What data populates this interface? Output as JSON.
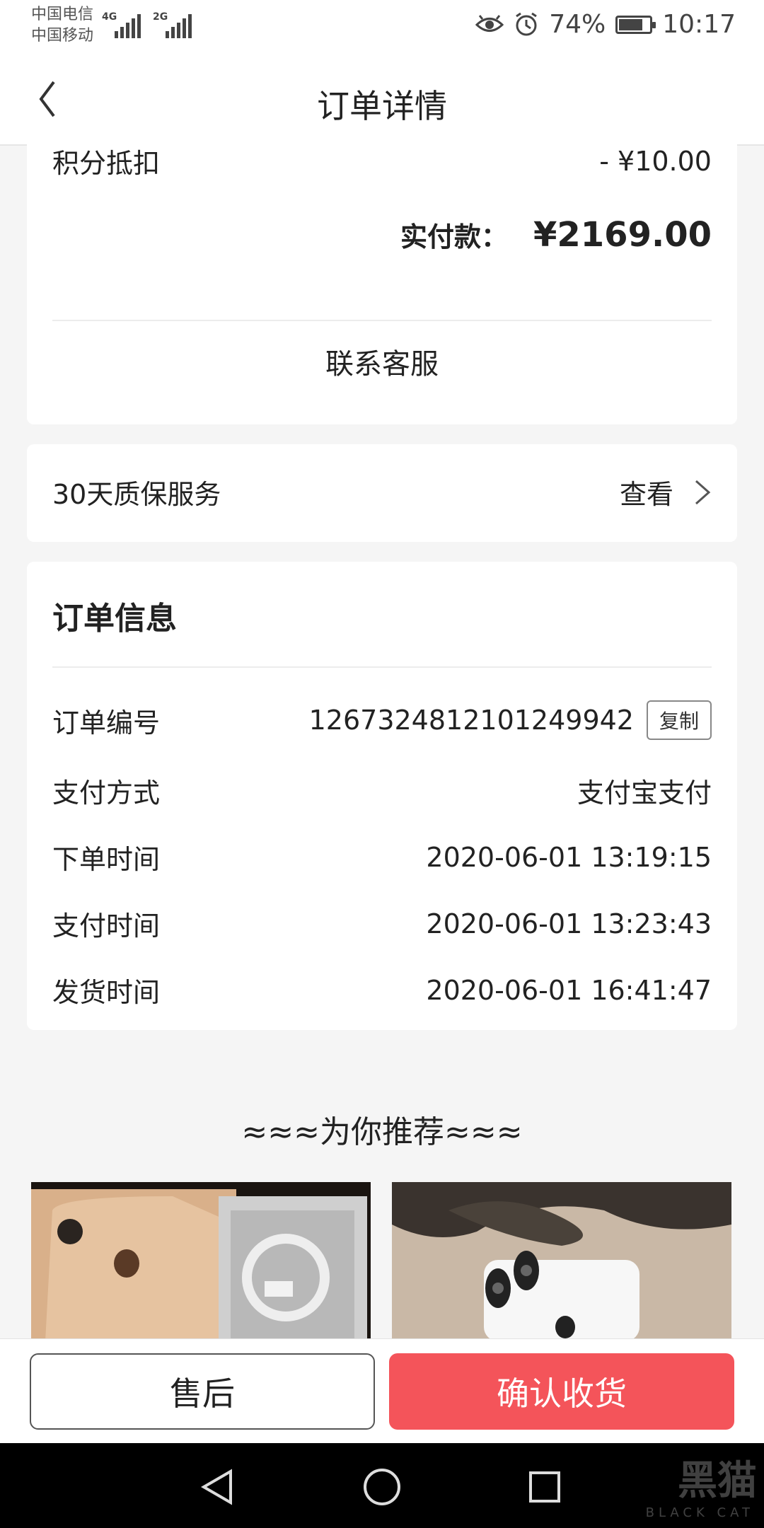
{
  "status_bar": {
    "carrier_1": "中国电信",
    "carrier_2": "中国移动",
    "net_1": "4G",
    "net_2": "2G",
    "battery_percent": "74%",
    "battery_level": 0.74,
    "time": "10:17",
    "icons": [
      "eye-icon",
      "alarm-icon",
      "battery-icon"
    ]
  },
  "header": {
    "title": "订单详情",
    "back_icon": "chevron-left-icon"
  },
  "payment_card": {
    "points_label": "积分抵扣",
    "points_value": "- ¥10.00",
    "paid_label": "实付款：",
    "paid_amount": "¥2169.00",
    "contact_label": "联系客服"
  },
  "warranty_card": {
    "label": "30天质保服务",
    "action": "查看"
  },
  "order_info": {
    "title": "订单信息",
    "rows": [
      {
        "label": "订单编号",
        "value": "1267324812101249942",
        "button": "复制"
      },
      {
        "label": "支付方式",
        "value": "支付宝支付"
      },
      {
        "label": "下单时间",
        "value": "2020-06-01 13:19:15"
      },
      {
        "label": "支付时间",
        "value": "2020-06-01 13:23:43"
      },
      {
        "label": "发货时间",
        "value": "2020-06-01 16:41:47"
      }
    ]
  },
  "recommend": {
    "title": "≈≈≈为你推荐≈≈≈"
  },
  "actions": {
    "after_sale": "售后",
    "confirm": "确认收货"
  },
  "watermark": {
    "text": "黑猫",
    "sub": "BLACK CAT"
  },
  "colors": {
    "accent": "#f4545a",
    "background": "#f5f5f5"
  }
}
